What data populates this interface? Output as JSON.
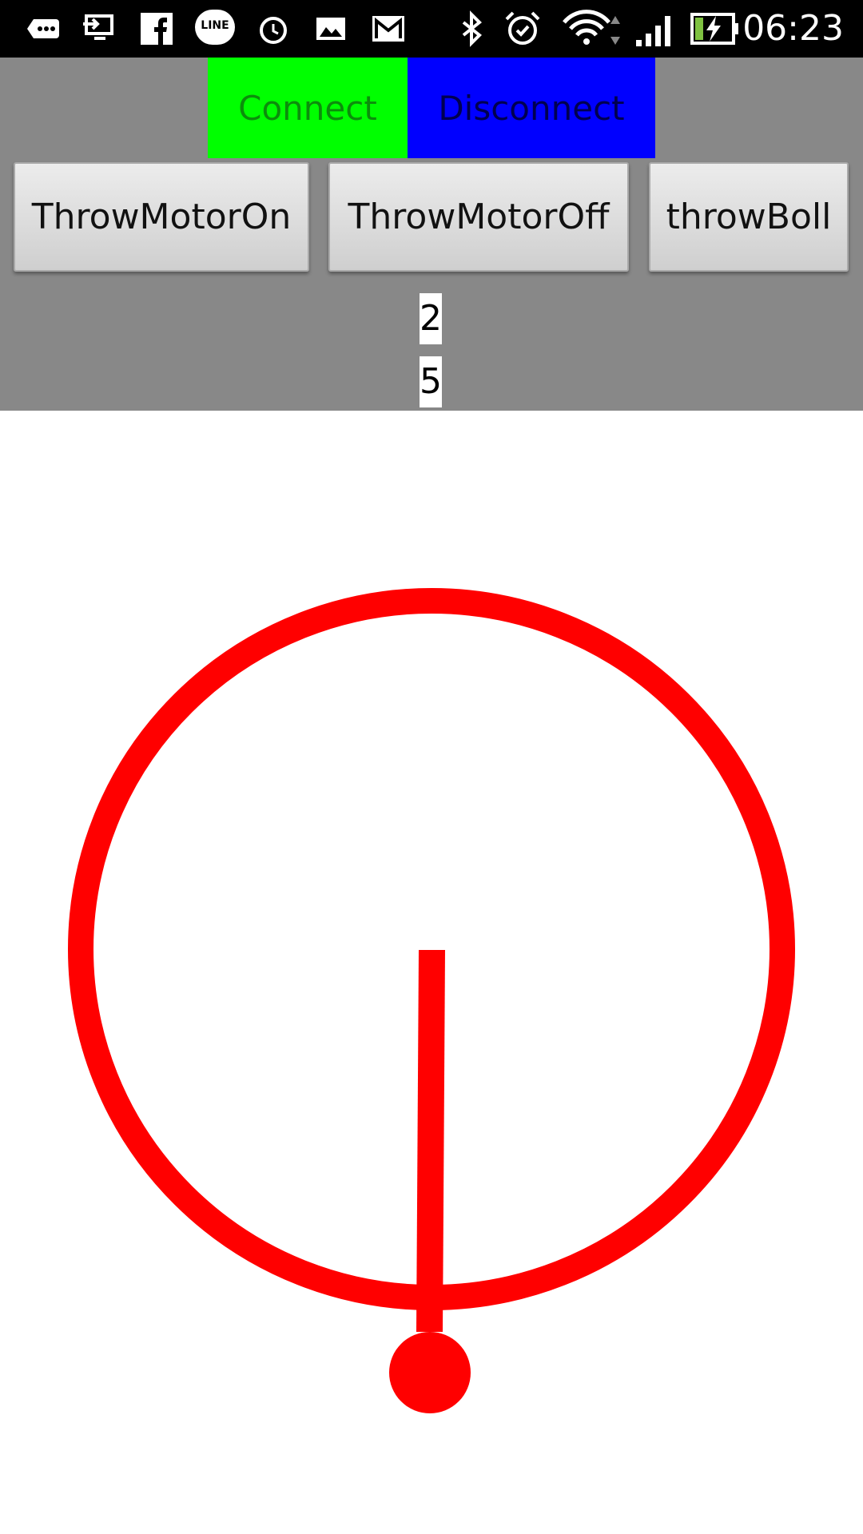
{
  "status_bar": {
    "time": "06:23",
    "icons": [
      "more-icon",
      "screen-cast-icon",
      "facebook-icon",
      "line-icon",
      "alarm-clock-icon",
      "gallery-icon",
      "gmail-icon",
      "bluetooth-icon",
      "alarm-icon",
      "wifi-icon",
      "signal-icon",
      "battery-charging-icon"
    ],
    "line_label": "LINE"
  },
  "connection": {
    "connect_label": "Connect",
    "disconnect_label": "Disconnect",
    "connect_color": "#00ff00",
    "disconnect_color": "#0000ff"
  },
  "motor_controls": {
    "on_label": "ThrowMotorOn",
    "off_label": "ThrowMotorOff",
    "throw_label": "throwBoll"
  },
  "readouts": {
    "value_1": "2",
    "value_2": "5"
  },
  "joystick": {
    "color": "#ff0000",
    "panel_color": "#888888"
  }
}
